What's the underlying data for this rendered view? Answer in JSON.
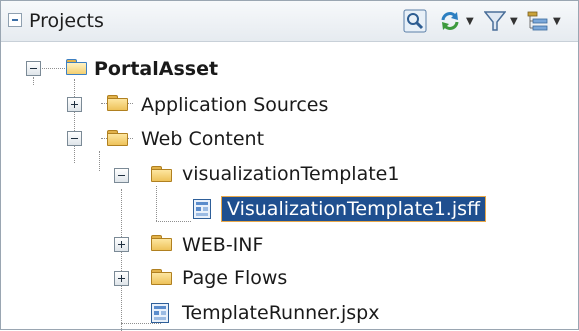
{
  "panel": {
    "title": "Projects",
    "toolbar": [
      {
        "icon": "search-icon",
        "has_dropdown": false
      },
      {
        "icon": "sync-icon",
        "has_dropdown": true
      },
      {
        "icon": "filter-icon",
        "has_dropdown": true
      },
      {
        "icon": "tree-options-icon",
        "has_dropdown": true
      }
    ]
  },
  "tree": {
    "root": {
      "label": "PortalAsset",
      "expanded": true
    },
    "items": [
      {
        "label": "Application Sources",
        "type": "folder",
        "expanded": false
      },
      {
        "label": "Web Content",
        "type": "folder",
        "expanded": true
      },
      {
        "label": "visualizationTemplate1",
        "type": "folder",
        "expanded": true
      },
      {
        "label": "VisualizationTemplate1.jsff",
        "type": "file",
        "selected": true
      },
      {
        "label": "WEB-INF",
        "type": "folder",
        "expanded": false
      },
      {
        "label": "Page Flows",
        "type": "folder",
        "expanded": false
      },
      {
        "label": "TemplateRunner.jspx",
        "type": "file",
        "selected": false
      }
    ]
  },
  "colors": {
    "selection_bg": "#1f4f8f",
    "selection_border": "#e8a84a",
    "folder": "#eec25a"
  }
}
